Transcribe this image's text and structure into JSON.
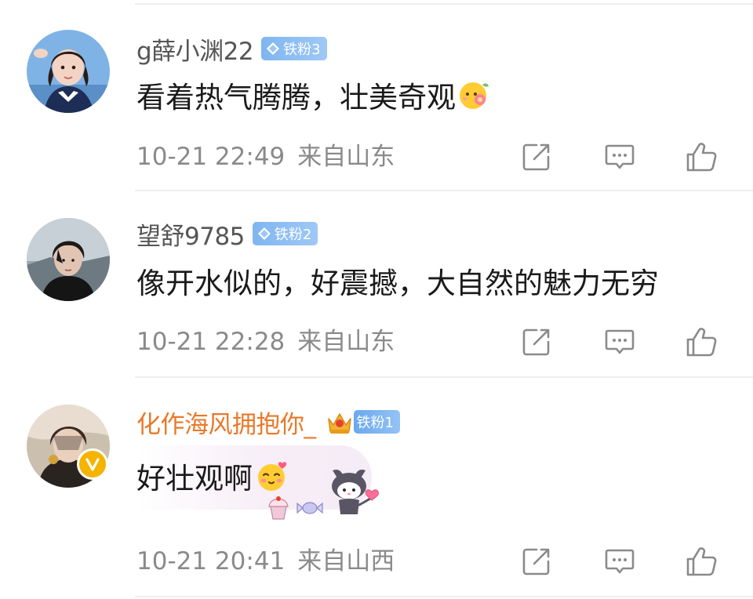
{
  "comments": [
    {
      "username": "g薛小渊22",
      "fan_badge": "铁粉3",
      "text": "看着热气腾腾，壮美奇观",
      "time": "10-21 22:49",
      "location": "来自山东",
      "is_vip": false
    },
    {
      "username": "望舒9785",
      "fan_badge": "铁粉2",
      "text": "像开水似的，好震撼，大自然的魅力无穷",
      "time": "10-21 22:28",
      "location": "来自山东",
      "is_vip": false
    },
    {
      "username": "化作海风拥抱你_",
      "fan_badge": "铁粉1",
      "text": "好壮观啊",
      "time": "10-21 20:41",
      "location": "来自山西",
      "is_vip": true
    }
  ],
  "icons": {
    "share": "share-icon",
    "comment": "comment-icon",
    "like": "like-icon",
    "fan_badge": "diamond-icon",
    "crown": "crown-icon",
    "verified": "v-badge-icon",
    "emoji": "flower-face-emoji"
  },
  "colors": {
    "vip_name": "#e8792a",
    "username": "#555555",
    "meta": "#8a8a8a",
    "fan_badge": "#8bbcf2",
    "verified": "#f5b400"
  }
}
